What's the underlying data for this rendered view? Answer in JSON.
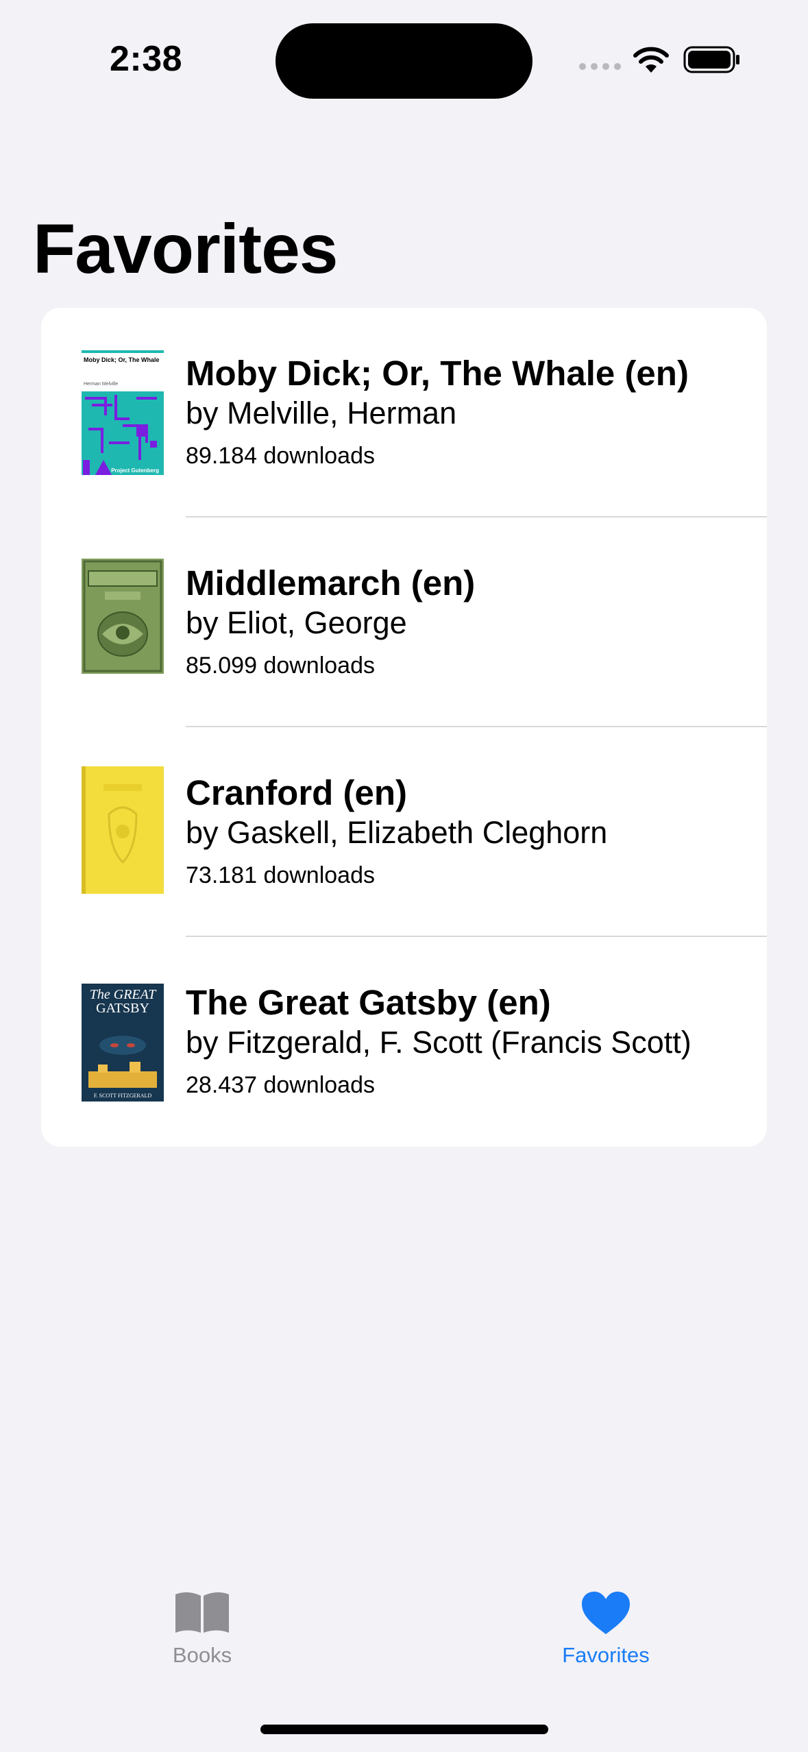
{
  "status_bar": {
    "time": "2:38"
  },
  "page": {
    "title": "Favorites"
  },
  "favorites": [
    {
      "title": "Moby Dick; Or, The Whale (en)",
      "author": "by Melville, Herman",
      "downloads": "89.184 downloads",
      "cover": {
        "heading": "Moby Dick; Or, The Whale",
        "sub": "Herman Melville",
        "publisher": "Project Gutenberg",
        "color": "#1fb8b0",
        "accent": "#7a1ee0"
      }
    },
    {
      "title": "Middlemarch (en)",
      "author": "by Eliot, George",
      "downloads": "85.099 downloads",
      "cover": {
        "color": "#7e9b5a"
      }
    },
    {
      "title": "Cranford (en)",
      "author": "by Gaskell, Elizabeth Cleghorn",
      "downloads": "73.181 downloads",
      "cover": {
        "color": "#f3dd3c"
      }
    },
    {
      "title": "The Great Gatsby (en)",
      "author": "by Fitzgerald, F. Scott (Francis Scott)",
      "downloads": "28.437 downloads",
      "cover": {
        "heading_line1": "The GREAT",
        "heading_line2": "GATSBY",
        "footer": "F. SCOTT FITZGERALD",
        "color": "#17364f"
      }
    }
  ],
  "tab_bar": {
    "books_label": "Books",
    "favorites_label": "Favorites",
    "selected": "favorites",
    "active_color": "#1a7cf6",
    "inactive_color": "#8e8e93"
  }
}
